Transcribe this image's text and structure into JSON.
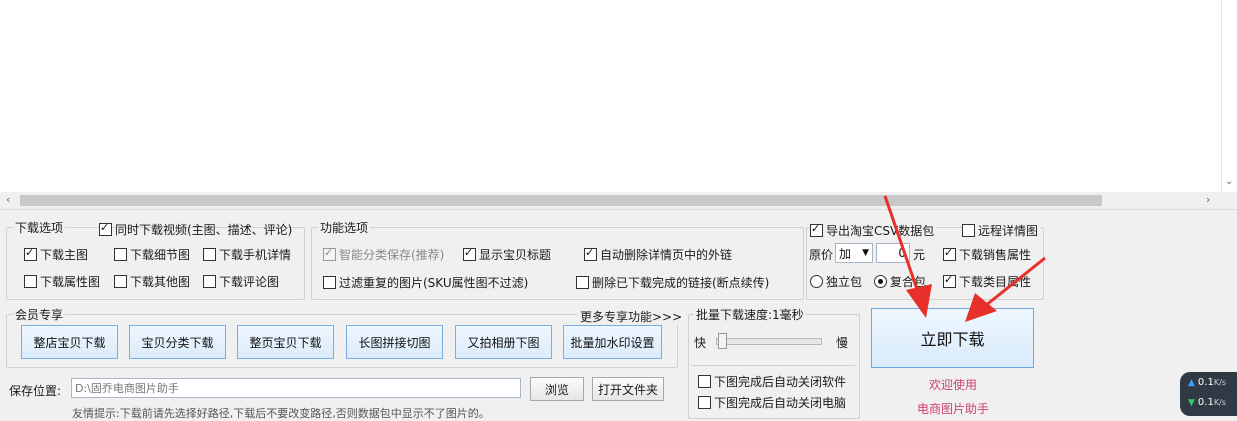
{
  "download_options": {
    "title": "下载选项",
    "video_label": "同时下载视频(主图、描述、评论)",
    "items": [
      {
        "label": "下载主图",
        "checked": true
      },
      {
        "label": "下载细节图",
        "checked": false
      },
      {
        "label": "下载手机详情",
        "checked": false
      },
      {
        "label": "下载属性图",
        "checked": false
      },
      {
        "label": "下载其他图",
        "checked": false
      },
      {
        "label": "下载评论图",
        "checked": false
      }
    ]
  },
  "function_options": {
    "title": "功能选项",
    "smart_save": "智能分类保存(推荐)",
    "show_title": "显示宝贝标题",
    "auto_delete_links": "自动删除详情页中的外链",
    "filter_duplicates": "过滤重复的图片(SKU属性图不过滤)",
    "delete_completed": "删除已下载完成的链接(断点续传)"
  },
  "export_options": {
    "export_csv": "导出淘宝CSV数据包",
    "remote_detail": "远程详情图",
    "price_label": "原价",
    "price_op": "加",
    "price_value": "0",
    "price_unit": "元",
    "download_sales_attr": "下载销售属性",
    "standalone": "独立包",
    "composite": "复合包",
    "download_category_attr": "下载类目属性"
  },
  "member": {
    "title": "会员专享",
    "more": "更多专享功能>>>",
    "buttons": [
      "整店宝贝下载",
      "宝贝分类下载",
      "整页宝贝下载",
      "长图拼接切图",
      "又拍相册下图",
      "批量加水印设置"
    ]
  },
  "speed": {
    "title": "批量下载速度:1毫秒",
    "fast": "快",
    "slow": "慢",
    "close_software": "下图完成后自动关闭软件",
    "close_computer": "下图完成后自动关闭电脑"
  },
  "save": {
    "label": "保存位置:",
    "path": "D:\\固乔电商图片助手",
    "browse": "浏览",
    "open_folder": "打开文件夹",
    "hint": "友情提示:下载前请先选择好路径,下载后不要改变路径,否则数据包中显示不了图片的。"
  },
  "download_now": "立即下载",
  "welcome_line1": "欢迎使用",
  "welcome_line2": "电商图片助手",
  "net_speed": {
    "up": "0.1",
    "down": "0.1",
    "unit": "K/s"
  },
  "colors": {
    "accent_border": "#7aaee0",
    "welcome": "#d0416b",
    "arrow": "#e8302a"
  }
}
